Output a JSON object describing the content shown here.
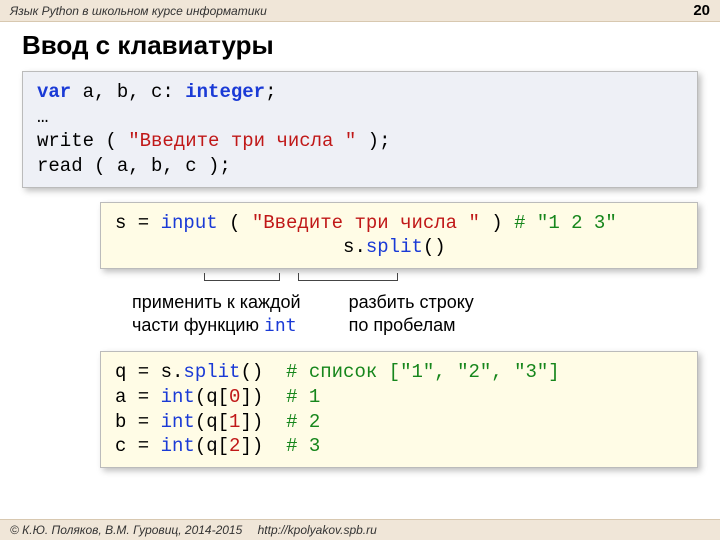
{
  "header": {
    "course": "Язык Python в школьном курсе информатики",
    "page": "20"
  },
  "title": "Ввод с клавиатуры",
  "pascal": {
    "l1a": "var",
    "l1b": " a, b, c: ",
    "l1c": "integer",
    "l1d": ";",
    "l2": "…",
    "l3a": "write ( ",
    "l3b": "\"Введите три числа \"",
    "l3c": " );",
    "l4": "read ( a, b, c );"
  },
  "py1": {
    "l1a": "s = ",
    "l1b": "input",
    "l1c": " ( ",
    "l1d": "\"Введите три числа \"",
    "l1e": " ) ",
    "l1f": "# \"1 2 3\"",
    "l2a": "s.",
    "l2b": "split",
    "l2c": "()"
  },
  "callouts": {
    "left1": "применить к каждой",
    "left2a": "части функцию ",
    "left2b": "int",
    "right1": "разбить строку",
    "right2": "по пробелам"
  },
  "py2": {
    "l1a": "q = s.",
    "l1b": "split",
    "l1c": "()  ",
    "l1d": "# список [\"1\", \"2\", \"3\"]",
    "l2a": "a = ",
    "l2b": "int",
    "l2c": "(q[",
    "l2d": "0",
    "l2e": "])  ",
    "l2f": "# 1",
    "l3a": "b = ",
    "l3b": "int",
    "l3c": "(q[",
    "l3d": "1",
    "l3e": "])  ",
    "l3f": "# 2",
    "l4a": "c = ",
    "l4b": "int",
    "l4c": "(q[",
    "l4d": "2",
    "l4e": "])  ",
    "l4f": "# 3"
  },
  "footer": {
    "copyright": "© К.Ю. Поляков, В.М. Гуровиц, 2014-2015",
    "url": "http://kpolyakov.spb.ru"
  }
}
